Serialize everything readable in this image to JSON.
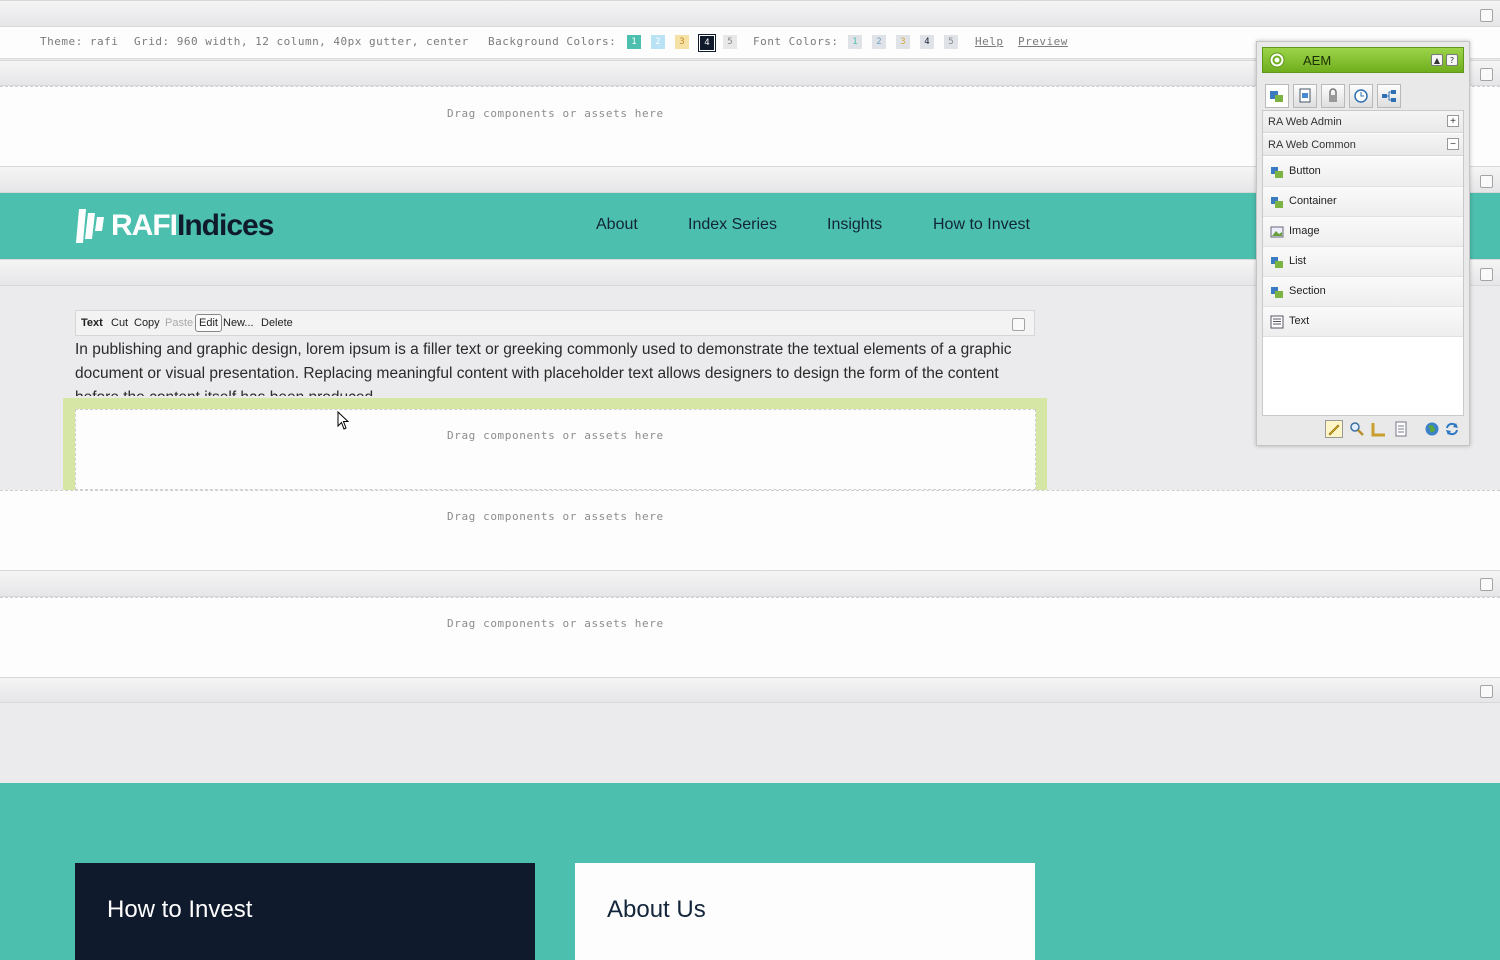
{
  "theme_bar": {
    "theme_text": "Theme: rafi",
    "grid_text": "Grid: 960 width, 12 column, 40px gutter, center",
    "bg_label": "Background Colors:",
    "bg_swatches": [
      {
        "label": "1",
        "color": "#4cbfae"
      },
      {
        "label": "2",
        "color": "#b9e2f5"
      },
      {
        "label": "3",
        "color": "#f5e1a6"
      },
      {
        "label": "4",
        "color": "#0f1a2c"
      },
      {
        "label": "5",
        "color": "#e8e8e8"
      }
    ],
    "font_label": "Font Colors:",
    "font_swatches": [
      {
        "label": "1",
        "color": "#d9dfe5"
      },
      {
        "label": "2",
        "color": "#d9dfe5"
      },
      {
        "label": "3",
        "color": "#d9dfe5"
      },
      {
        "label": "4",
        "color": "#d9dfe5"
      },
      {
        "label": "5",
        "color": "#d9dfe5"
      }
    ],
    "help": "Help",
    "preview": "Preview"
  },
  "dropzone_text": "Drag components or assets here",
  "header": {
    "logo_rafi": "RAFI",
    "logo_indices": "Indices",
    "nav": [
      "About",
      "Index Series",
      "Insights",
      "How to Invest"
    ]
  },
  "edit_toolbar": {
    "label": "Text",
    "cut": "Cut",
    "copy": "Copy",
    "paste": "Paste",
    "edit": "Edit",
    "new": "New...",
    "delete": "Delete"
  },
  "body_text": "In publishing and graphic design, lorem ipsum is a filler text or greeking commonly used to demonstrate the textual elements of a graphic document or visual presentation. Replacing meaningful content with placeholder text allows designers to design the form of the content before the content itself has been produced.",
  "sidekick": {
    "title": "AEM",
    "groups": [
      "RA Web Admin",
      "RA Web Common"
    ],
    "items": [
      "Button",
      "Container",
      "Image",
      "List",
      "Section",
      "Text"
    ]
  },
  "footer": {
    "cards": [
      "How to Invest",
      "About Us"
    ]
  },
  "colors": {
    "teal": "#4cbfae",
    "navy": "#0f1a2c",
    "highlight": "#d5e6a5",
    "aem_green": "#8cc63f"
  }
}
